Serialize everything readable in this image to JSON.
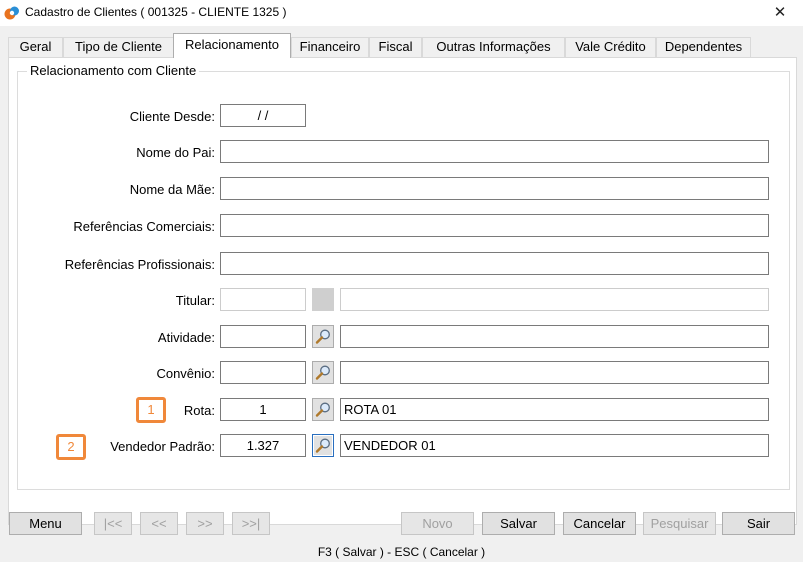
{
  "window": {
    "title": "Cadastro de Clientes ( 001325 - CLIENTE 1325 )",
    "close_glyph": "✕"
  },
  "tabs": [
    {
      "label": "Geral"
    },
    {
      "label": "Tipo de Cliente"
    },
    {
      "label": "Relacionamento"
    },
    {
      "label": "Financeiro"
    },
    {
      "label": "Fiscal"
    },
    {
      "label": "Outras Informações"
    },
    {
      "label": "Vale Crédito"
    },
    {
      "label": "Dependentes"
    }
  ],
  "active_tab": "Relacionamento",
  "group": {
    "title": "Relacionamento com Cliente"
  },
  "form": {
    "cliente_desde": {
      "label": "Cliente Desde:",
      "value": " /  /"
    },
    "nome_pai": {
      "label": "Nome do Pai:",
      "value": ""
    },
    "nome_mae": {
      "label": "Nome da Mãe:",
      "value": ""
    },
    "ref_comerciais": {
      "label": "Referências Comerciais:",
      "value": ""
    },
    "ref_profissionais": {
      "label": "Referências Profissionais:",
      "value": ""
    },
    "titular": {
      "label": "Titular:",
      "code": "",
      "description": ""
    },
    "atividade": {
      "label": "Atividade:",
      "code": "",
      "description": ""
    },
    "convenio": {
      "label": "Convênio:",
      "code": "",
      "description": ""
    },
    "rota": {
      "label": "Rota:",
      "code": "1",
      "description": "ROTA 01",
      "marker": "1"
    },
    "vendedor": {
      "label": "Vendedor Padrão:",
      "code": "1.327",
      "description": "VENDEDOR 01",
      "marker": "2"
    }
  },
  "buttons": {
    "menu": "Menu",
    "first": "|<<",
    "prev": "<<",
    "next": ">>",
    "last": ">>|",
    "novo": "Novo",
    "salvar": "Salvar",
    "cancelar": "Cancelar",
    "pesquisar": "Pesquisar",
    "sair": "Sair"
  },
  "status": {
    "text": "F3 ( Salvar )  -  ESC ( Cancelar )"
  },
  "colors": {
    "marker": "#f0883a",
    "focus": "#2a6fbf",
    "app_icon_orange": "#e8731f",
    "app_icon_blue": "#2a8fd6"
  },
  "icons": {
    "search": "magnifier-icon",
    "app": "app-logo-icon",
    "close": "close-icon"
  }
}
